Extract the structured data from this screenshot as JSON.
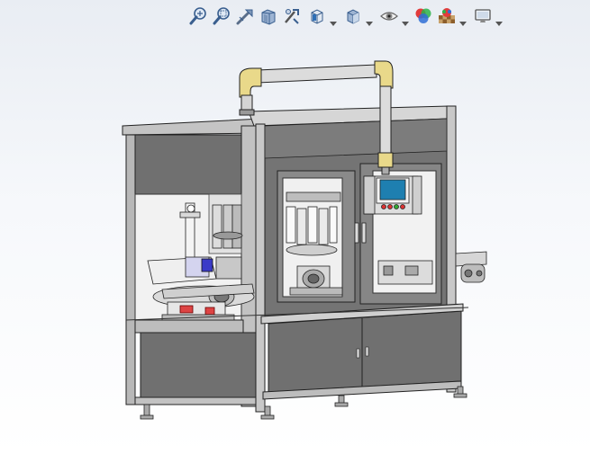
{
  "toolbar": {
    "buttons": [
      {
        "name": "zoom-to-fit-icon"
      },
      {
        "name": "zoom-to-area-icon"
      },
      {
        "name": "previous-view-icon"
      },
      {
        "name": "section-view-icon"
      },
      {
        "name": "dynamic-annotation-views-icon"
      },
      {
        "name": "view-orientation-icon",
        "dropdown": true
      },
      {
        "name": "display-style-icon",
        "dropdown": true
      },
      {
        "name": "hide-show-items-icon",
        "dropdown": true
      },
      {
        "name": "edit-appearance-icon"
      },
      {
        "name": "apply-scene-icon",
        "dropdown": true
      },
      {
        "name": "view-settings-icon",
        "dropdown": true
      }
    ]
  },
  "model": {
    "name": "labeling-filling-machine-assembly",
    "colors": {
      "frame": "#b5b5b5",
      "panel_dark": "#6e6e6e",
      "panel_light": "#9a9a9a",
      "pipe": "#d8d8d8",
      "pipe_elbow": "#e9d98a",
      "screen": "#1e7fb0"
    }
  }
}
